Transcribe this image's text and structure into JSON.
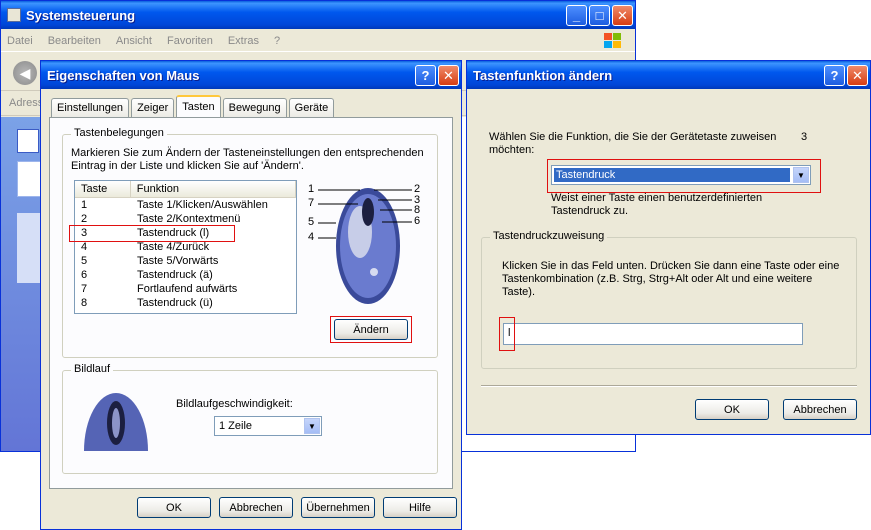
{
  "control_panel": {
    "title": "Systemsteuerung",
    "menu": [
      "Datei",
      "Bearbeiten",
      "Ansicht",
      "Favoriten",
      "Extras",
      "?"
    ],
    "address_label": "Adress"
  },
  "mouse_props": {
    "title": "Eigenschaften von Maus",
    "tabs": [
      "Einstellungen",
      "Zeiger",
      "Tasten",
      "Bewegung",
      "Geräte"
    ],
    "active_tab": "Tasten",
    "buttons_group": {
      "legend": "Tastenbelegungen",
      "instruction": "Markieren Sie zum Ändern der Tasteneinstellungen den entsprechenden Eintrag in der Liste und klicken Sie auf 'Ändern'.",
      "columns": [
        "Taste",
        "Funktion"
      ],
      "rows": [
        {
          "taste": "1",
          "funktion": "Taste 1/Klicken/Auswählen"
        },
        {
          "taste": "2",
          "funktion": "Taste 2/Kontextmenü"
        },
        {
          "taste": "3",
          "funktion": "Tastendruck (l)"
        },
        {
          "taste": "4",
          "funktion": "Taste 4/Zurück"
        },
        {
          "taste": "5",
          "funktion": "Taste 5/Vorwärts"
        },
        {
          "taste": "6",
          "funktion": "Tastendruck (ä)"
        },
        {
          "taste": "7",
          "funktion": "Fortlaufend aufwärts"
        },
        {
          "taste": "8",
          "funktion": "Tastendruck (ü)"
        }
      ],
      "mouse_labels_left": [
        "1",
        "7",
        "5",
        "4"
      ],
      "mouse_labels_right": [
        "2",
        "3",
        "8",
        "6"
      ],
      "change_button": "Ändern"
    },
    "scroll_group": {
      "legend": "Bildlauf",
      "speed_label": "Bildlaufgeschwindigkeit:",
      "speed_value": "1 Zeile"
    },
    "footer": {
      "ok": "OK",
      "cancel": "Abbrechen",
      "apply": "Übernehmen",
      "help": "Hilfe"
    }
  },
  "change_dialog": {
    "title": "Tastenfunktion ändern",
    "prompt": "Wählen Sie die Funktion, die Sie der Gerätetaste zuweisen möchten:",
    "device_button_number": "3",
    "function_value": "Tastendruck",
    "function_description": "Weist einer Taste einen benutzerdefinierten Tastendruck zu.",
    "assignment_group": {
      "legend": "Tastendruckzuweisung",
      "instruction": "Klicken Sie in das Feld unten. Drücken Sie dann eine Taste oder eine Tastenkombination (z.B. Strg, Strg+Alt oder Alt und eine weitere Taste).",
      "field_value": "l"
    },
    "ok": "OK",
    "cancel": "Abbrechen"
  },
  "colors": {
    "titlebar": "#0054e3",
    "highlight_box": "#e01010",
    "selection": "#316ac5"
  }
}
